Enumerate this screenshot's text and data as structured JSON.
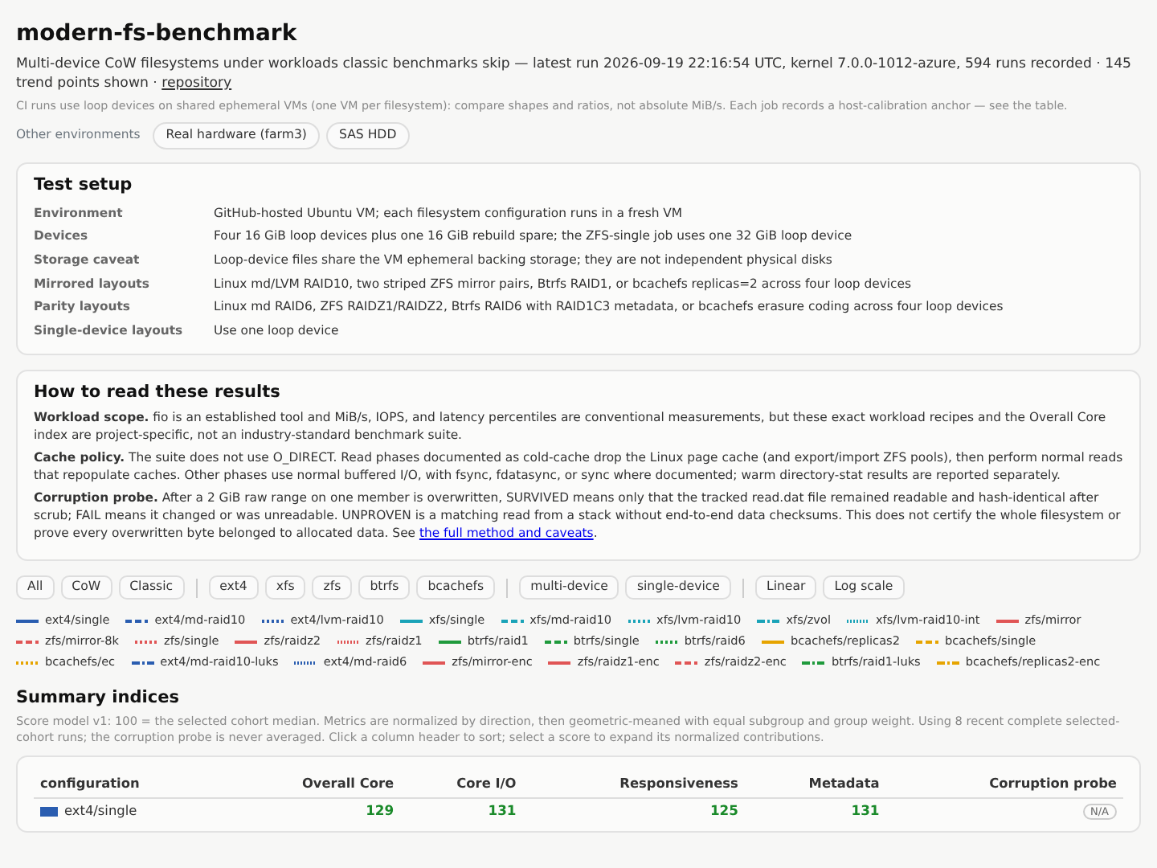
{
  "title": "modern-fs-benchmark",
  "subtitle": "Multi-device CoW filesystems under workloads classic benchmarks skip — latest run 2026-09-19 22:16:54 UTC, kernel 7.0.0-1012-azure, 594 runs recorded · 145 trend points shown · ",
  "repository_link": "repository",
  "note": "CI runs use loop devices on shared ephemeral VMs (one VM per filesystem): compare shapes and ratios, not absolute MiB/s. Each job records a host-calibration anchor — see the table.",
  "other_environments": {
    "label": "Other environments",
    "links": [
      "Real hardware (farm3)",
      "SAS HDD"
    ]
  },
  "test_setup": {
    "title": "Test setup",
    "rows": [
      {
        "label": "Environment",
        "value": "GitHub-hosted Ubuntu VM; each filesystem configuration runs in a fresh VM"
      },
      {
        "label": "Devices",
        "value": "Four 16 GiB loop devices plus one 16 GiB rebuild spare; the ZFS-single job uses one 32 GiB loop device"
      },
      {
        "label": "Storage caveat",
        "value": "Loop-device files share the VM ephemeral backing storage; they are not independent physical disks"
      },
      {
        "label": "Mirrored layouts",
        "value": "Linux md/LVM RAID10, two striped ZFS mirror pairs, Btrfs RAID1, or bcachefs replicas=2 across four loop devices"
      },
      {
        "label": "Parity layouts",
        "value": "Linux md RAID6, ZFS RAIDZ1/RAIDZ2, Btrfs RAID6 with RAID1C3 metadata, or bcachefs erasure coding across four loop devices"
      },
      {
        "label": "Single-device layouts",
        "value": "Use one loop device"
      }
    ]
  },
  "how_to_read": {
    "title": "How to read these results",
    "paragraphs": [
      {
        "text": "**Workload scope.** fio is an established tool and MiB/s, IOPS, and latency percentiles are conventional measurements, but these exact workload recipes and the Overall Core index are project-specific, not an industry-standard benchmark suite."
      },
      {
        "text": "**Cache policy.** The suite does not use O_DIRECT. Read phases documented as cold-cache drop the Linux page cache (and export/import ZFS pools), then perform normal reads that repopulate caches. Other phases use normal buffered I/O, with fsync, fdatasync, or sync where documented; warm directory-stat results are reported separately."
      },
      {
        "text": "**Corruption probe.** After a 2 GiB raw range on one member is overwritten, SURVIVED means only that the tracked read.dat file remained readable and hash-identical after scrub; FAIL means it changed or was unreadable. UNPROVEN is a matching read from a stack without end-to-end data checksums. This does not certify the whole filesystem or prove every overwritten byte belonged to allocated data. See ",
        "link": "the full method and caveats",
        "after": "."
      }
    ]
  },
  "filter_groups": [
    [
      "All",
      "CoW",
      "Classic"
    ],
    [
      "ext4",
      "xfs",
      "zfs",
      "btrfs",
      "bcachefs"
    ],
    [
      "multi-device",
      "single-device"
    ],
    [
      "Linear",
      "Log scale"
    ]
  ],
  "legend_items": [
    {
      "label": "ext4/single",
      "color": "#2a5db0",
      "kind": "solid"
    },
    {
      "label": "ext4/md-raid10",
      "color": "#2a5db0",
      "kind": "dashed"
    },
    {
      "label": "ext4/lvm-raid10",
      "color": "#2a5db0",
      "kind": "dotted"
    },
    {
      "label": "xfs/single",
      "color": "#1aa3b8",
      "kind": "solid"
    },
    {
      "label": "xfs/md-raid10",
      "color": "#1aa3b8",
      "kind": "dashed"
    },
    {
      "label": "xfs/lvm-raid10",
      "color": "#1aa3b8",
      "kind": "dotted"
    },
    {
      "label": "xfs/zvol",
      "color": "#1aa3b8",
      "kind": "dashdot"
    },
    {
      "label": "xfs/lvm-raid10-int",
      "color": "#1aa3b8",
      "kind": "finedot"
    },
    {
      "label": "zfs/mirror",
      "color": "#e05555",
      "kind": "solid"
    },
    {
      "label": "zfs/mirror-8k",
      "color": "#e05555",
      "kind": "dashed"
    },
    {
      "label": "zfs/single",
      "color": "#e05555",
      "kind": "dotted"
    },
    {
      "label": "zfs/raidz2",
      "color": "#e05555",
      "kind": "solid"
    },
    {
      "label": "zfs/raidz1",
      "color": "#e05555",
      "kind": "finedot"
    },
    {
      "label": "btrfs/raid1",
      "color": "#1f9a3c",
      "kind": "solid"
    },
    {
      "label": "btrfs/single",
      "color": "#1f9a3c",
      "kind": "dashed"
    },
    {
      "label": "btrfs/raid6",
      "color": "#1f9a3c",
      "kind": "dotted"
    },
    {
      "label": "bcachefs/replicas2",
      "color": "#e6a400",
      "kind": "solid"
    },
    {
      "label": "bcachefs/single",
      "color": "#e6a400",
      "kind": "dashed"
    },
    {
      "label": "bcachefs/ec",
      "color": "#e6a400",
      "kind": "dotted"
    },
    {
      "label": "ext4/md-raid10-luks",
      "color": "#2a5db0",
      "kind": "dashdot"
    },
    {
      "label": "ext4/md-raid6",
      "color": "#2a5db0",
      "kind": "finedot"
    },
    {
      "label": "zfs/mirror-enc",
      "color": "#e05555",
      "kind": "solid"
    },
    {
      "label": "zfs/raidz1-enc",
      "color": "#e05555",
      "kind": "solid"
    },
    {
      "label": "zfs/raidz2-enc",
      "color": "#e05555",
      "kind": "dashed"
    },
    {
      "label": "btrfs/raid1-luks",
      "color": "#1f9a3c",
      "kind": "dashdot"
    },
    {
      "label": "bcachefs/replicas2-enc",
      "color": "#e6a400",
      "kind": "dashdot"
    }
  ],
  "summary": {
    "title": "Summary indices",
    "description": "Score model v1: 100 = the selected cohort median. Metrics are normalized by direction, then geometric-meaned with equal subgroup and group weight. Using 8 recent complete selected-cohort runs; the corruption probe is never averaged. Click a column header to sort; select a score to expand its normalized contributions.",
    "columns": [
      "configuration",
      "Overall Core",
      "Core I/O",
      "Responsiveness",
      "Metadata",
      "Corruption probe"
    ],
    "rows": [
      {
        "configuration": "ext4/single",
        "color": "#2a5db0",
        "overall_core": "129",
        "core_io": "131",
        "responsiveness": "125",
        "metadata": "131",
        "corruption_probe": "N/A"
      }
    ]
  }
}
